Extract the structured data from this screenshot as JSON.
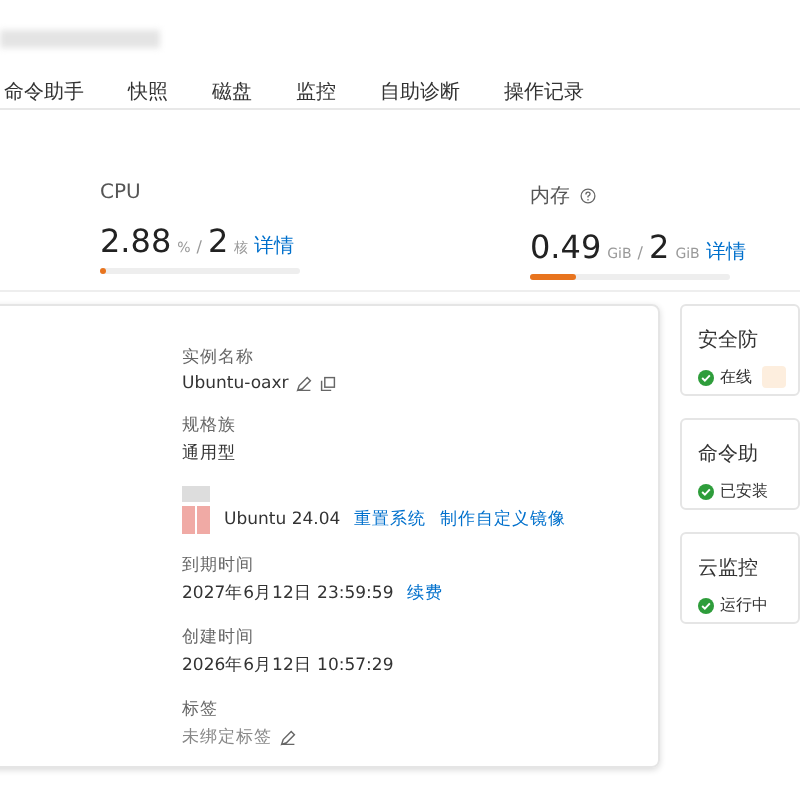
{
  "tabs": [
    {
      "label": "命令助手",
      "selected": false
    },
    {
      "label": "快照",
      "selected": false
    },
    {
      "label": "磁盘",
      "selected": false
    },
    {
      "label": "监控",
      "selected": false
    },
    {
      "label": "自助诊断",
      "selected": false
    },
    {
      "label": "操作记录",
      "selected": false
    }
  ],
  "metrics": [
    {
      "label": "CPU",
      "help": false,
      "value": "2.88",
      "unit": "%",
      "separator": "/",
      "total": "2",
      "total_unit": "核",
      "link": "详情",
      "level": 0.02
    },
    {
      "label": "内存",
      "help": true,
      "value": "0.49",
      "unit": "GiB",
      "separator": "/",
      "total": "2",
      "total_unit": "GiB",
      "link": "详情",
      "level": 0.23
    }
  ],
  "details": [
    {
      "label": "实例名称",
      "value": "Ubuntu-oaxr",
      "kind": "name"
    },
    {
      "label": "规格族",
      "value": "通用型",
      "kind": "plain"
    },
    {
      "value": "Ubuntu 24.04",
      "links": [
        "重置系统",
        "制作自定义镜像"
      ],
      "kind": "os"
    },
    {
      "label": "到期时间",
      "value": "2027年6月12日 23:59:59",
      "links": [
        "续费"
      ],
      "kind": "plain"
    },
    {
      "label": "创建时间",
      "value": "2026年6月12日 10:57:29",
      "kind": "plain"
    },
    {
      "label": "标签",
      "value": "未绑定标签",
      "kind": "tag"
    }
  ],
  "side_cards": [
    {
      "title": "安全防",
      "status": "在线",
      "badge": true
    },
    {
      "title": "命令助",
      "status": "已安装",
      "badge": false
    },
    {
      "title": "云监控",
      "status": "运行中",
      "badge": false
    }
  ]
}
